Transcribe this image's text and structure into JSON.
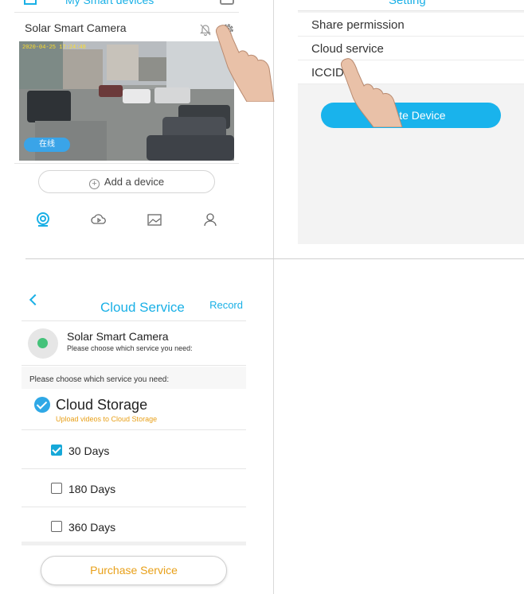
{
  "panel_devices": {
    "title": "My Smart devices",
    "device_name": "Solar Smart Camera",
    "timestamp": "2020-04-25 17:24:48",
    "status_badge": "在线",
    "add_device": "Add a device",
    "tabs": [
      "camera-icon",
      "cloud-play-icon",
      "gallery-icon",
      "profile-icon"
    ]
  },
  "panel_setting": {
    "title": "Setting",
    "items": [
      "Share permission",
      "Cloud service",
      "ICCID"
    ],
    "delete_button": "Delete Device"
  },
  "panel_cloud": {
    "title": "Cloud Service",
    "record": "Record",
    "device_name": "Solar Smart Camera",
    "device_hint": "Please choose which service you need:",
    "choose_label": "Please choose which service you need:",
    "storage_title": "Cloud Storage",
    "storage_sub": "Upload videos to Cloud Storage",
    "options": [
      {
        "label": "30 Days",
        "checked": true
      },
      {
        "label": "180 Days",
        "checked": false
      },
      {
        "label": "360 Days",
        "checked": false
      }
    ],
    "purchase": "Purchase Service"
  },
  "colors": {
    "accent": "#1ab0e6",
    "orange": "#e8a019"
  }
}
